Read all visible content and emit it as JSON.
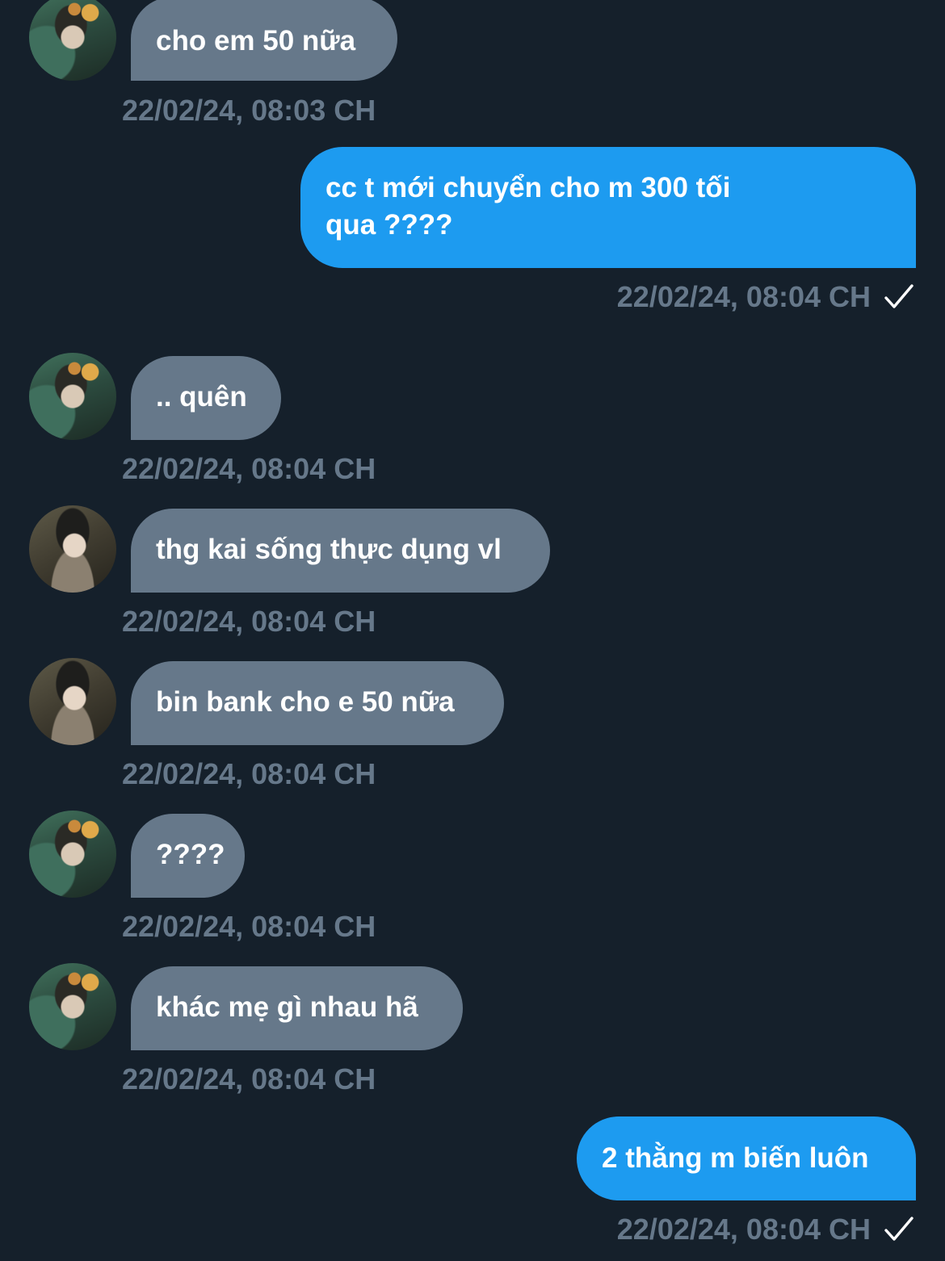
{
  "conversation": {
    "messages": [
      {
        "sender": "contact-a",
        "text": "cho em 50 nữa",
        "timestamp": "22/02/24, 08:03 CH"
      },
      {
        "sender": "me",
        "text_line1": "cc t mới chuyển cho m 300 tối",
        "text_line2": "qua ????",
        "timestamp": "22/02/24, 08:04 CH",
        "status_icon": "check-icon"
      },
      {
        "sender": "contact-a",
        "text": ".. quên",
        "timestamp": "22/02/24, 08:04 CH"
      },
      {
        "sender": "contact-b",
        "text": "thg kai sống thực dụng vl",
        "timestamp": "22/02/24, 08:04 CH"
      },
      {
        "sender": "contact-b",
        "text": "bin bank cho e 50 nữa",
        "timestamp": "22/02/24, 08:04 CH"
      },
      {
        "sender": "contact-a",
        "text": "????",
        "timestamp": "22/02/24, 08:04 CH"
      },
      {
        "sender": "contact-a",
        "text": "khác mẹ gì nhau hã",
        "timestamp": "22/02/24, 08:04 CH"
      },
      {
        "sender": "me",
        "text": "2 thằng m biến luôn",
        "timestamp": "22/02/24, 08:04 CH",
        "status_icon": "check-icon"
      }
    ]
  },
  "colors": {
    "background": "#15202b",
    "incoming_bubble": "#66788a",
    "outgoing_bubble": "#1d9bf0",
    "timestamp_text": "#66788a",
    "message_text": "#ffffff"
  }
}
